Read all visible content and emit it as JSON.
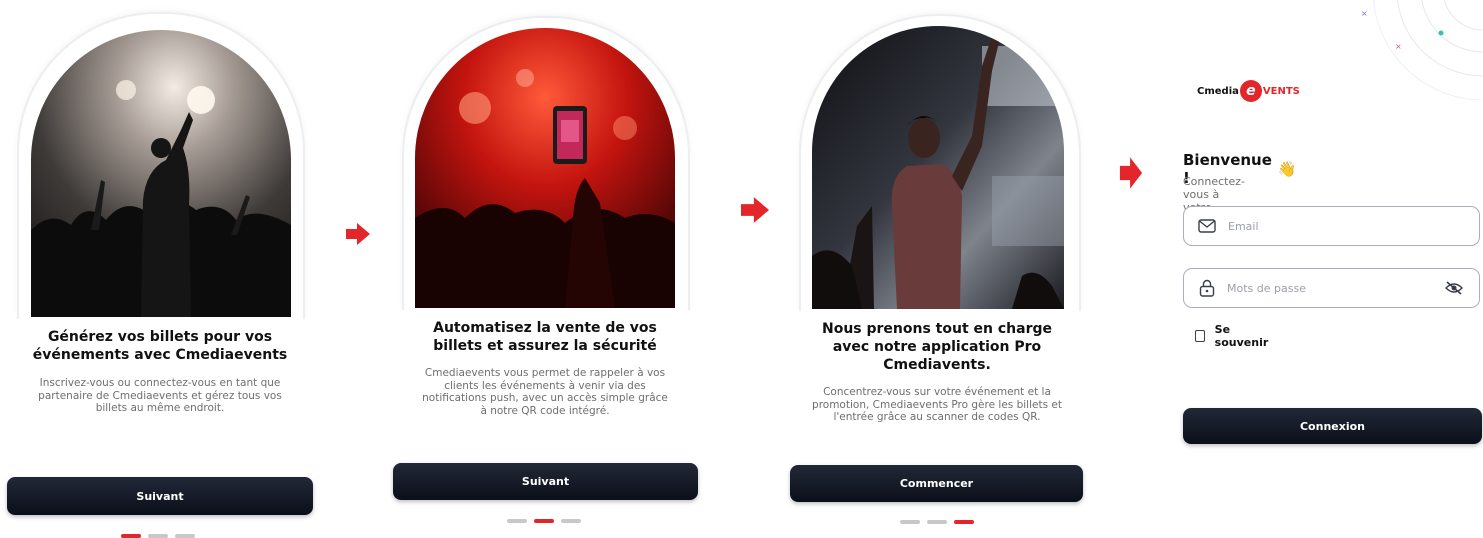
{
  "screens": [
    {
      "title_lines": [
        "Générez vos billets pour vos",
        "événements avec Cmediaevents"
      ],
      "desc_lines": [
        "Inscrivez-vous ou connectez-vous en tant que",
        "partenaire de Cmediaevents et gérez tous vos",
        "billets au même endroit."
      ],
      "button_label": "Suivant",
      "active_dot": 0
    },
    {
      "title_lines": [
        "Automatisez la vente de vos",
        "billets et assurez la sécurité"
      ],
      "desc_lines": [
        "Cmediaevents vous permet de rappeler à vos",
        "clients les événements à venir via des",
        "notifications push, avec un accès simple grâce",
        "à notre QR code intégré."
      ],
      "button_label": "Suivant",
      "active_dot": 1
    },
    {
      "title_lines": [
        "Nous prenons tout en charge",
        "avec notre application Pro",
        "Cmediavents."
      ],
      "desc_lines": [
        "Concentrez-vous sur votre événement et la",
        "promotion, Cmediaevents Pro gère les billets et",
        "l'entrée grâce au scanner de codes QR."
      ],
      "button_label": "Commencer",
      "active_dot": 2
    }
  ],
  "login": {
    "logo_prefix": "Cmedia",
    "logo_letter": "e",
    "logo_suffix": "VENTS",
    "welcome": "Bienvenue !",
    "welcome_emoji": "👋",
    "subtitle": "Connectez-vous à votre compte",
    "email_placeholder": "Email",
    "password_placeholder": "Mots de passe",
    "remember_label": "Se souvenir",
    "submit_label": "Connexion"
  },
  "colors": {
    "accent": "#e3262a",
    "button_dark": "#111827",
    "dot_inactive": "#c8c8c8"
  },
  "icons": [
    "arrow-right-icon",
    "mail-icon",
    "lock-icon",
    "eye-off-icon",
    "checkbox-icon",
    "waving-hand-icon"
  ]
}
